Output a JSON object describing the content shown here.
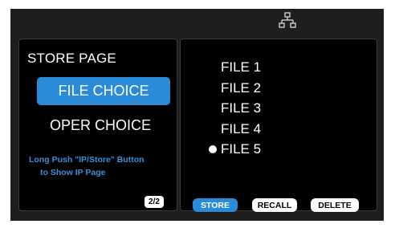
{
  "left_panel": {
    "title": "STORE PAGE",
    "file_choice_label": "FILE CHOICE",
    "oper_choice_label": "OPER CHOICE",
    "hint_line1": "Long Push \"IP/Store\" Button",
    "hint_line2": "to Show IP Page",
    "page_indicator": "2/2"
  },
  "right_panel": {
    "files": [
      {
        "label": "FILE 1",
        "selected": false
      },
      {
        "label": "FILE 2",
        "selected": false
      },
      {
        "label": "FILE 3",
        "selected": false
      },
      {
        "label": "FILE 4",
        "selected": false
      },
      {
        "label": "FILE 5",
        "selected": true
      }
    ],
    "actions": {
      "store": "STORE",
      "recall": "RECALL",
      "delete": "DELETE"
    }
  },
  "icons": {
    "network": "network-icon"
  },
  "colors": {
    "accent": "#2a8bd8",
    "hint_text": "#3d8fd6",
    "background": "#000000"
  }
}
